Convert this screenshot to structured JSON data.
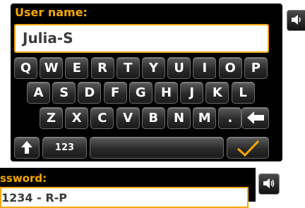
{
  "username_dialog": {
    "title": "User name:",
    "value": "Julia-S"
  },
  "keyboard": {
    "row1": [
      "Q",
      "W",
      "E",
      "R",
      "T",
      "Y",
      "U",
      "I",
      "O",
      "P"
    ],
    "row2": [
      "A",
      "S",
      "D",
      "F",
      "G",
      "H",
      "J",
      "K",
      "L"
    ],
    "row3": [
      "Z",
      "X",
      "C",
      "V",
      "B",
      "N",
      "M",
      "."
    ],
    "numbers_label": "123"
  },
  "password_dialog": {
    "title": "ssword:",
    "value": "1234 - R-P"
  },
  "icons": {
    "volume": "speaker-icon",
    "backspace": "left-arrow-icon",
    "shift": "up-arrow-icon",
    "confirm": "checkmark-icon"
  },
  "colors": {
    "accent": "#f7a800",
    "panel": "#000000",
    "key": "#2a2a2a"
  }
}
